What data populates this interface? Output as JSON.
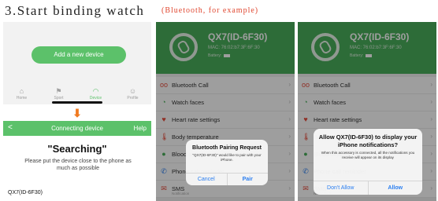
{
  "step_title": "3.Start binding watch",
  "example_note": "(Bluetooth, for example)",
  "home": {
    "add_device": "Add a new device",
    "tabs": [
      {
        "label": "Home",
        "icon": "home-icon"
      },
      {
        "label": "Sport",
        "icon": "sport-icon"
      },
      {
        "label": "Device",
        "icon": "device-icon"
      },
      {
        "label": "Profile",
        "icon": "profile-icon"
      }
    ]
  },
  "connecting": {
    "header_title": "Connecting device",
    "help": "Help",
    "back": "<",
    "searching": "\"Searching\"",
    "hint": "Please put the device close to the phone as much as possible",
    "found_device": "QX7(ID-6F30)"
  },
  "device": {
    "name": "QX7(ID-6F30)",
    "mac": "MAC: 76:02:b7:3F:6F:30",
    "battery": "Battery:"
  },
  "menu": [
    {
      "label": "Bluetooth Call",
      "icon": "phone-icon",
      "color": "#e74c3c"
    },
    {
      "label": "Watch faces",
      "icon": "watch-face-icon",
      "color": "#4aae5b"
    },
    {
      "label": "Heart rate settings",
      "icon": "heart-icon",
      "color": "#e74c3c"
    },
    {
      "label": "Body temperature",
      "icon": "thermometer-icon",
      "color": "#e74c3c"
    },
    {
      "label": "Blood oxygen",
      "icon": "blood-oxygen-icon",
      "color": "#4aae5b"
    },
    {
      "label": "Phone call reminder",
      "icon": "call-icon",
      "color": "#2a7ef0"
    },
    {
      "label": "SMS",
      "sub": "Notification",
      "icon": "sms-icon",
      "color": "#e74c3c"
    }
  ],
  "pairing_dialog": {
    "title": "Bluetooth Pairing Request",
    "message": "\"QX7(ID-6F30)\" would like to pair with your iPhone.",
    "cancel": "Cancel",
    "confirm": "Pair"
  },
  "notify_dialog": {
    "title": "Allow QX7(ID-6F30) to display your iPhone notifications?",
    "message": "When this accessory is connected, all the notifications you receive will appear on its display",
    "deny": "Don't Allow",
    "confirm": "Allow"
  },
  "colors": {
    "brand_green": "#5cc16a",
    "header_green": "#4aae5b",
    "arrow_orange": "#f07a20",
    "note_red": "#e0462f",
    "ios_blue": "#2a7ef0"
  }
}
